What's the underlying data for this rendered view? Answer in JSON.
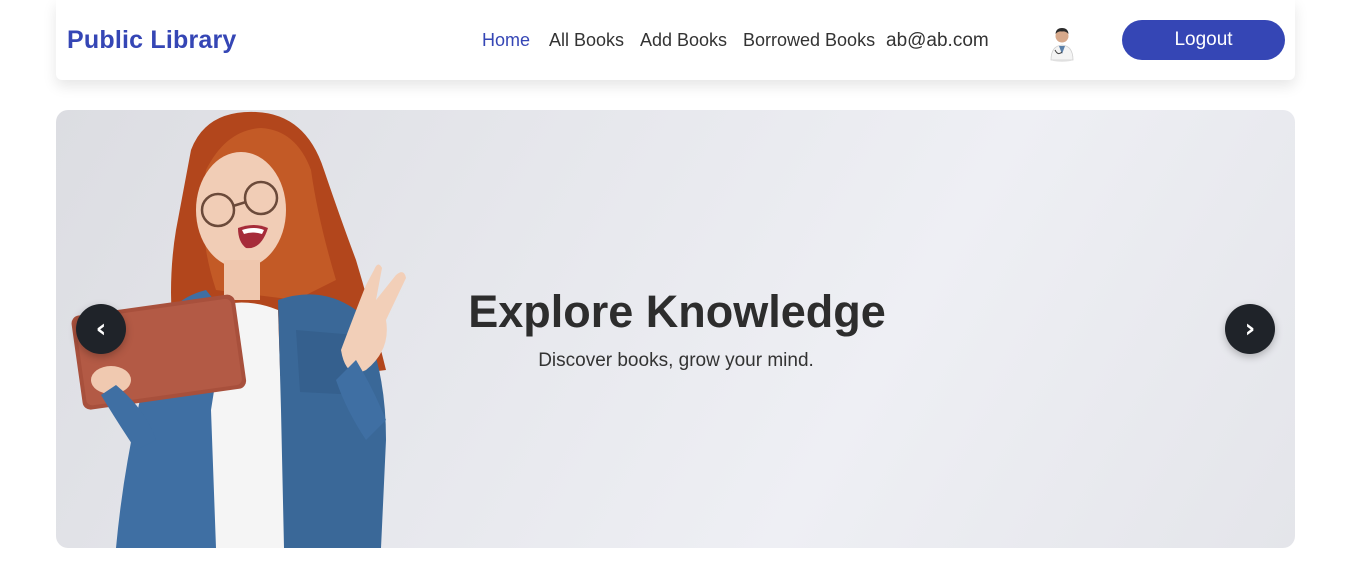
{
  "navbar": {
    "brand": "Public Library",
    "links": [
      {
        "label": "Home",
        "active": true
      },
      {
        "label": "All Books",
        "active": false
      },
      {
        "label": "Add Books",
        "active": false
      },
      {
        "label": "Borrowed Books",
        "active": false
      }
    ],
    "user_email": "ab@ab.com",
    "avatar_icon": "user-avatar",
    "logout_label": "Logout"
  },
  "hero": {
    "title": "Explore Knowledge",
    "subtitle": "Discover books, grow your mind.",
    "prev_icon": "chevron-left-icon",
    "next_icon": "chevron-right-icon",
    "prev_glyph": "‹",
    "next_glyph": "›"
  },
  "colors": {
    "brand": "#3546b5",
    "text": "#2d2d2d",
    "arrow_bg": "#1f2329"
  }
}
